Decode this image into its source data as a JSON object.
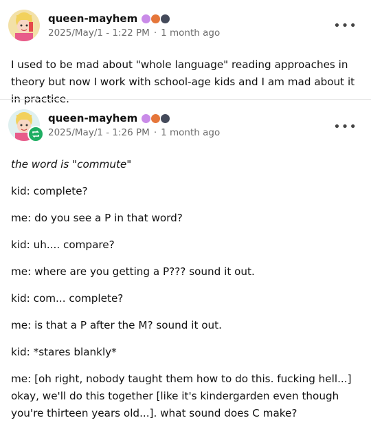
{
  "post1": {
    "username": "queen-mayhem",
    "date": "2025/May/1 - 1:22 PM",
    "ago": "1 month ago",
    "text": "I used to be mad about \"whole language\" reading approaches in theory but now I work with school-age kids and I am mad about it in practice."
  },
  "post2": {
    "username": "queen-mayhem",
    "date": "2025/May/1 - 1:26 PM",
    "ago": "1 month ago",
    "lines": [
      "the word is \"commute\"",
      "kid: complete?",
      "me: do you see a P in that word?",
      "kid: uh.... compare?",
      "me: where are you getting a P??? sound it out.",
      "kid: com... complete?",
      "me: is that a P after the M? sound it out.",
      "kid: *stares blankly*",
      "me: [oh right, nobody taught them how to do this. fucking hell...] okay, we'll do this together [like it's kindergarden even though you're thirteen years old...]. what sound does C make?"
    ]
  },
  "ui": {
    "more_label": "•••",
    "separator": "·"
  },
  "colors": {
    "badge1": "#c98be8",
    "badge2": "#e5763a",
    "badge3": "#444a5a",
    "reblog": "#1fae62"
  },
  "icons": [
    "avatar-icon",
    "badge-icon",
    "reblog-icon",
    "more-icon"
  ]
}
